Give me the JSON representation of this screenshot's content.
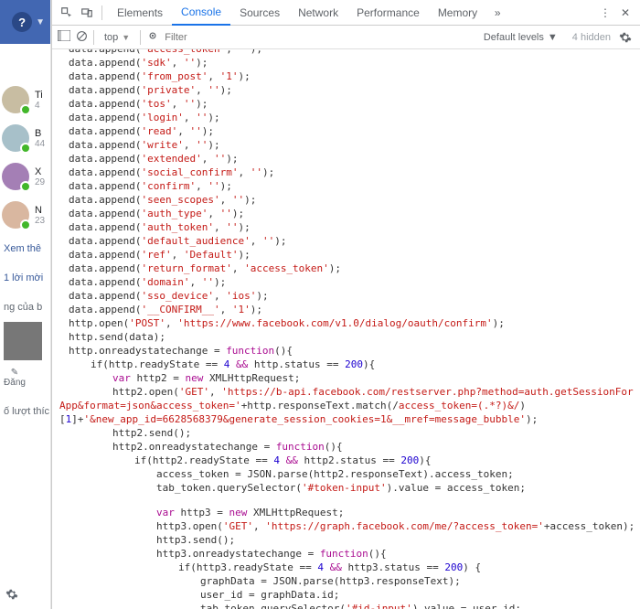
{
  "fb": {
    "contacts": [
      {
        "name": "Ti",
        "sub": "4",
        "color": "#c8bda2"
      },
      {
        "name": "B",
        "sub": "44",
        "color": "#a7c0c9"
      },
      {
        "name": "X",
        "sub": "29",
        "color": "#a47fb5"
      },
      {
        "name": "N",
        "sub": "23",
        "color": "#d9b7a0"
      }
    ],
    "see_more": "Xem thê",
    "invite": "1 lời mời",
    "yours": "ng của b",
    "edit": "Đăng",
    "likes": "ố lượt thíc"
  },
  "devtools": {
    "tabs": [
      "Elements",
      "Console",
      "Sources",
      "Network",
      "Performance",
      "Memory"
    ],
    "active": "Console",
    "context": "top",
    "filter_placeholder": "Filter",
    "levels": "Default levels",
    "hidden": "4 hidden"
  },
  "code": {
    "appends": [
      [
        "access_token",
        ""
      ],
      [
        "sdk",
        ""
      ],
      [
        "from_post",
        "1"
      ],
      [
        "private",
        ""
      ],
      [
        "tos",
        ""
      ],
      [
        "login",
        ""
      ],
      [
        "read",
        ""
      ],
      [
        "write",
        ""
      ],
      [
        "extended",
        ""
      ],
      [
        "social_confirm",
        ""
      ],
      [
        "confirm",
        ""
      ],
      [
        "seen_scopes",
        ""
      ],
      [
        "auth_type",
        ""
      ],
      [
        "auth_token",
        ""
      ],
      [
        "default_audience",
        ""
      ],
      [
        "ref",
        "Default"
      ],
      [
        "return_format",
        "access_token"
      ],
      [
        "domain",
        ""
      ],
      [
        "sso_device",
        "ios"
      ],
      [
        "__CONFIRM__",
        "1"
      ]
    ],
    "open_post": "https://www.facebook.com/v1.0/dialog/oauth/confirm",
    "or_state": "http.onreadystatechange = ",
    "fn_kw": "function",
    "if1_pre": "if(http.readyState == ",
    "if1_mid": " && http.status == ",
    "four": "4",
    "twohundred": "200",
    "var_kw": "var",
    "new_kw": "new",
    "xhr": " XMLHttpRequest;",
    "http2_decl": " http2 = ",
    "http2_open_pre": "http2.open(",
    "get": "GET",
    "rest_url": "https://b-api.facebook.com/restserver.php?method=auth.getSessionForApp&format=json&access_token=",
    "match_tail": "+http.responseText.match(/",
    "regex": "access_token=(.*?)&/",
    "idx1": "1",
    "after_idx": "]+",
    "newapp": "&new_app_id=6628568379&generate_session_cookies=1&__mref=message_bubble",
    "http2_send": "http2.send();",
    "http2_or": "http2.onreadystatechange = ",
    "if2_pre": "if(http2.readyState == ",
    "if2_mid": " && http2.status == ",
    "line_at": "access_token = JSON.parse(http2.responseText).access_token;",
    "line_tt": "tab_token.querySelector(",
    "tokeninput": "#token-input",
    "eq_at": ").value = access_token;",
    "http3_decl": " http3 = ",
    "http3_open_pre": "http3.open(",
    "graph_me": "https://graph.facebook.com/me/?access_token=",
    "plus_at": "+access_token);",
    "http3_send": "http3.send();",
    "http3_or": "http3.onreadystatechange = ",
    "if3_pre": "if(http3.readyState == ",
    "if3_mid": " && http3.status == ",
    "gd_parse": "graphData = JSON.parse(http3.responseText);",
    "uid": "user_id = graphData.id;",
    "idinput": "#id-input",
    "eq_uid": ").value = user_id;"
  }
}
